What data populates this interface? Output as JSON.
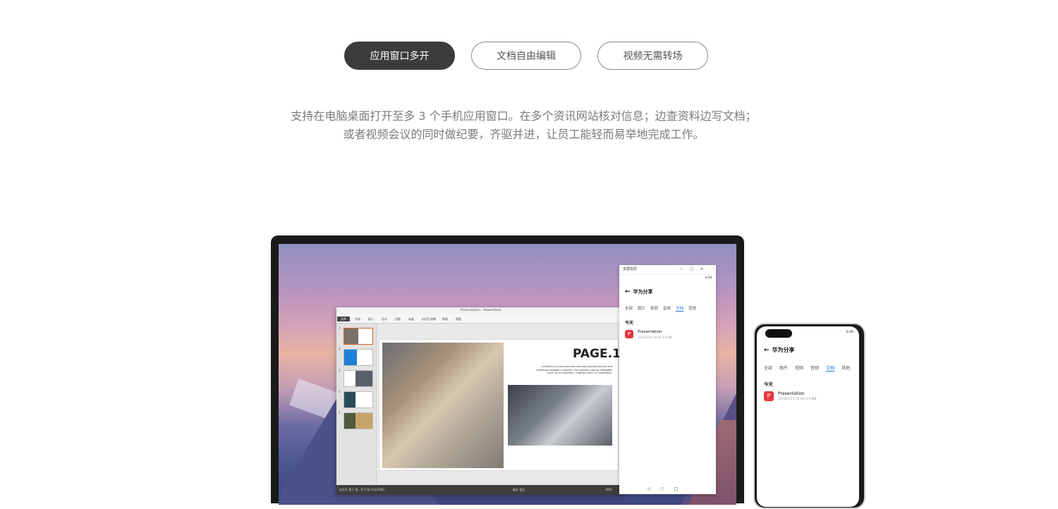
{
  "tabs": [
    {
      "label": "应用窗口多开",
      "active": true
    },
    {
      "label": "文档自由编辑",
      "active": false
    },
    {
      "label": "视频无需转场",
      "active": false
    }
  ],
  "description": {
    "line1": "支持在电脑桌面打开至多 3 个手机应用窗口。在多个资讯网站核对信息；边查资料边写文档；",
    "line2": "或者视频会议的同时做纪要，齐驱并进，让员工能轻而易举地完成工作。"
  },
  "ppt": {
    "title": "Presentation - PowerPoint",
    "file_tab": "文件",
    "menu": [
      "开始",
      "插入",
      "设计",
      "切换",
      "动画",
      "幻灯片放映",
      "审阅",
      "视图"
    ],
    "slide_numbers": [
      "1",
      "2",
      "3",
      "4",
      "5"
    ],
    "slide_title": "PAGE.1",
    "slide_body": "Creativity is a phenomenon whereby something new and somehow valuable is formed. The creation may be intangible (such as an invention, a literary work, or a painting).",
    "status_left": "幻灯片 第 1 张，共 5 张   中文(中国)",
    "status_right": "备注  批注",
    "zoom": "80%"
  },
  "phone_window": {
    "title": "多屏协同",
    "time": "8:08",
    "header": "华为分享",
    "tabs": [
      "全部",
      "图片",
      "视频",
      "音频",
      "文档",
      "其他"
    ],
    "selected_tab": "文档",
    "section": "今天",
    "file_icon": "P",
    "file_name": "Presentation",
    "file_meta": "2020/5/14 16:40 5.4 MB"
  },
  "phone": {
    "time": "8:08",
    "header": "华为分享",
    "tabs": [
      "全部",
      "图片",
      "视频",
      "音频",
      "文档",
      "其他"
    ],
    "selected_tab": "文档",
    "section": "今天",
    "file_icon": "P",
    "file_name": "Presentation",
    "file_meta": "2020/5/14 16:40 5.4 MB"
  }
}
